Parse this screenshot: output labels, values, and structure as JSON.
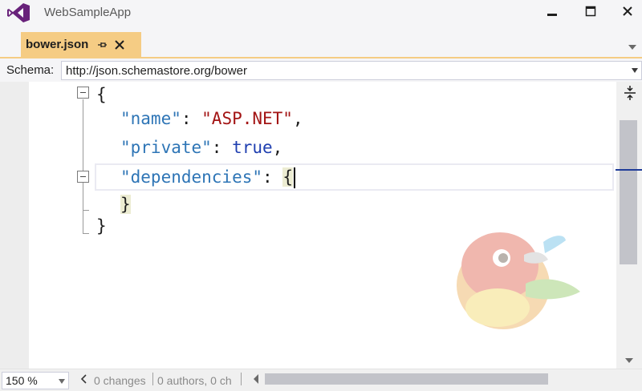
{
  "window": {
    "title": "WebSampleApp",
    "icons": [
      "visual-studio-logo",
      "minimize-icon",
      "maximize-icon",
      "close-icon"
    ]
  },
  "tab": {
    "label": "bower.json",
    "icons": [
      "pin-icon",
      "close-icon"
    ]
  },
  "schema": {
    "label": "Schema:",
    "value": "http://json.schemastore.org/bower"
  },
  "editor": {
    "lines": [
      {
        "open": "{"
      },
      {
        "key": "\"name\"",
        "sep": ": ",
        "string": "\"ASP.NET\"",
        "end": ","
      },
      {
        "key": "\"private\"",
        "sep": ": ",
        "bool": "true",
        "end": ","
      },
      {
        "key": "\"dependencies\"",
        "sep": ": ",
        "open": "{"
      },
      {
        "close": "}"
      },
      {
        "close": "}"
      }
    ],
    "background_logo": "bower-logo"
  },
  "status": {
    "zoom": "150 %",
    "changes": "0 changes",
    "authors": "0 authors, 0 ch"
  },
  "colors": {
    "tab_accent": "#f5cc84",
    "json_key": "#2e75b6",
    "json_string": "#a31515",
    "json_keyword": "#1f3fb0",
    "vs_purple": "#68217a"
  }
}
